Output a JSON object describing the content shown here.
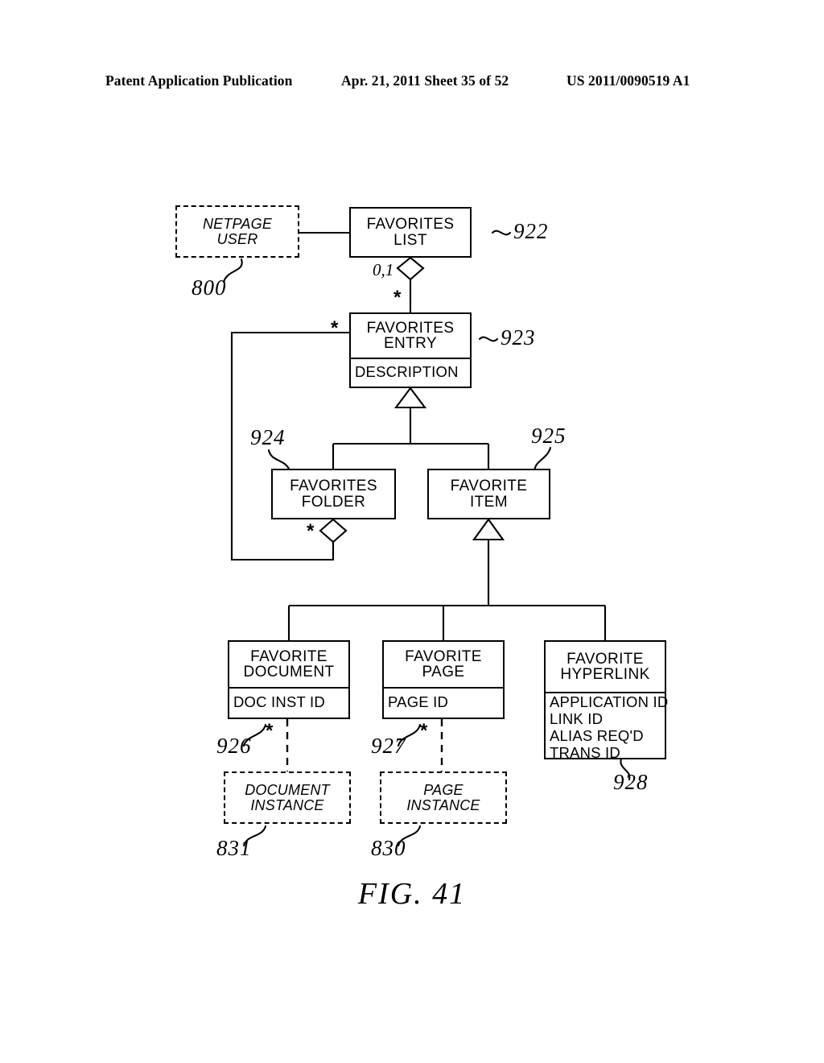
{
  "header": {
    "left": "Patent Application Publication",
    "middle": "Apr. 21, 2011  Sheet 35 of 52",
    "right": "US 2011/0090519 A1"
  },
  "figure": {
    "caption": "FIG. 41"
  },
  "nodes": {
    "netpage_user": {
      "title_line1": "NETPAGE",
      "title_line2": "USER",
      "ref": "800"
    },
    "favorites_list": {
      "title_line1": "FAVORITES",
      "title_line2": "LIST",
      "ref": "922"
    },
    "favorites_entry": {
      "title_line1": "FAVORITES",
      "title_line2": "ENTRY",
      "ref": "923",
      "attributes": [
        "DESCRIPTION"
      ]
    },
    "favorites_folder": {
      "title_line1": "FAVORITES",
      "title_line2": "FOLDER",
      "ref": "924"
    },
    "favorite_item": {
      "title_line1": "FAVORITE",
      "title_line2": "ITEM",
      "ref": "925"
    },
    "favorite_document": {
      "title_line1": "FAVORITE",
      "title_line2": "DOCUMENT",
      "ref": "926",
      "attributes": [
        "DOC INST ID"
      ]
    },
    "favorite_page": {
      "title_line1": "FAVORITE",
      "title_line2": "PAGE",
      "ref": "927",
      "attributes": [
        "PAGE ID"
      ]
    },
    "favorite_hyperlink": {
      "title_line1": "FAVORITE",
      "title_line2": "HYPERLINK",
      "ref": "928",
      "attributes": [
        "APPLICATION ID",
        "LINK ID",
        "ALIAS REQ'D",
        "TRANS ID"
      ]
    },
    "document_instance": {
      "title_line1": "DOCUMENT",
      "title_line2": "INSTANCE",
      "ref": "831"
    },
    "page_instance": {
      "title_line1": "PAGE",
      "title_line2": "INSTANCE",
      "ref": "830"
    }
  },
  "multiplicities": {
    "list_to_entry_aggregation": "0,1",
    "entry_many": "*",
    "folder_contains_entry": "*",
    "folder_aggregation_many": "*",
    "document_instance_many": "*",
    "page_instance_many": "*"
  },
  "colors": {
    "ink": "#000000",
    "paper": "#ffffff"
  }
}
